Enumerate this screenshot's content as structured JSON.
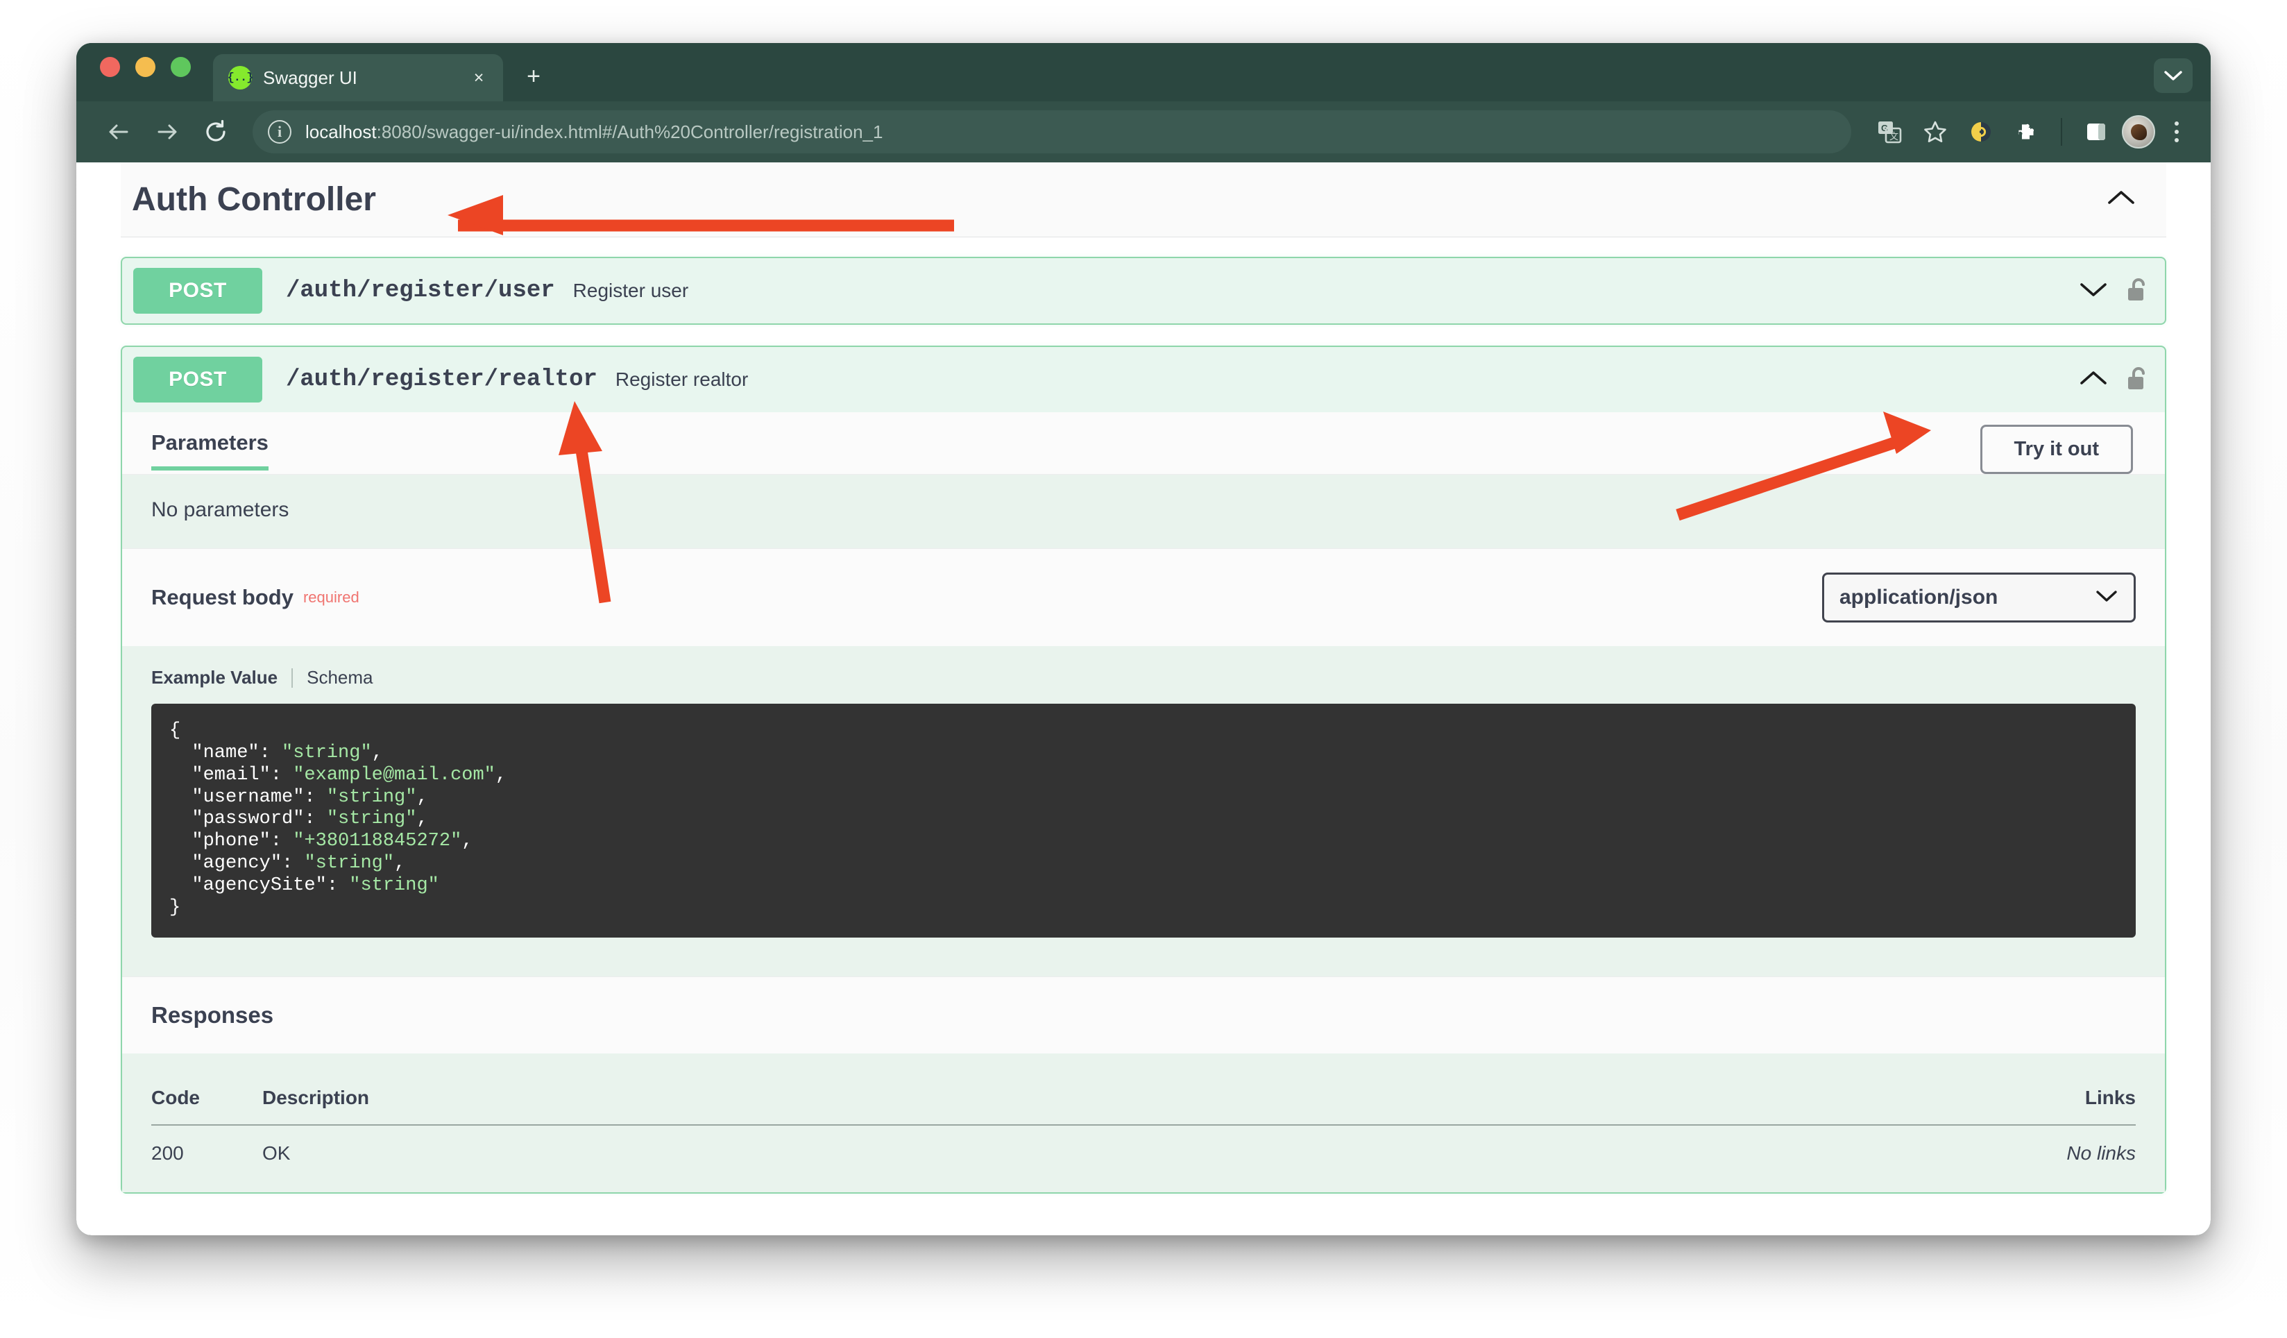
{
  "browser": {
    "window_controls": [
      "close",
      "minimize",
      "maximize"
    ],
    "tab": {
      "title": "Swagger UI",
      "favicon": "{..}",
      "close_label": "×"
    },
    "new_tab_label": "+",
    "tab_list_chevron": "chevron-down",
    "toolbar": {
      "back_label": "←",
      "forward_label": "→",
      "reload_label": "↻",
      "site_info_label": "i",
      "url_host": "localhost",
      "url_rest": ":8080/swagger-ui/index.html#/Auth%20Controller/registration_1",
      "url_full": "localhost:8080/swagger-ui/index.html#/Auth%20Controller/registration_1",
      "icons": [
        "translate-icon",
        "bookmark-star-icon",
        "extension-badge-icon",
        "puzzle-extension-icon",
        "side-panel-icon",
        "profile-avatar",
        "menu-kebab-icon"
      ]
    }
  },
  "swagger": {
    "tag_section": {
      "title": "Auth Controller",
      "collapse_chevron": "chevron-up"
    },
    "operations": [
      {
        "method": "POST",
        "path": "/auth/register/user",
        "summary": "Register user",
        "expanded": false,
        "chevron": "chevron-down",
        "lock": "unlocked-padlock"
      },
      {
        "method": "POST",
        "path": "/auth/register/realtor",
        "summary": "Register realtor",
        "expanded": true,
        "chevron": "chevron-up",
        "lock": "unlocked-padlock"
      }
    ],
    "expanded_operation": {
      "parameters_tab": "Parameters",
      "try_it_out": "Try it out",
      "no_parameters": "No parameters",
      "request_body_label": "Request body",
      "required_badge": "required",
      "media_type_selected": "application/json",
      "media_type_options": [
        "application/json"
      ],
      "example_value_tab": "Example Value",
      "schema_tab": "Schema",
      "example_json_lines": [
        "{",
        "  \"name\": \"string\",",
        "  \"email\": \"example@mail.com\",",
        "  \"username\": \"string\",",
        "  \"password\": \"string\",",
        "  \"phone\": \"+380118845272\",",
        "  \"agency\": \"string\",",
        "  \"agencySite\": \"string\"",
        "}"
      ],
      "example_json_fields": {
        "name": "string",
        "email": "example@mail.com",
        "username": "string",
        "password": "string",
        "phone": "+380118845272",
        "agency": "string",
        "agencySite": "string"
      },
      "responses_title": "Responses",
      "responses_table": {
        "headers": [
          "Code",
          "Description",
          "Links"
        ],
        "rows": [
          {
            "code": "200",
            "description": "OK",
            "links": "No links"
          }
        ]
      }
    }
  },
  "annotations": {
    "color": "#ec4524",
    "arrows": [
      {
        "name": "arrow-to-auth-controller-title",
        "points_to": "Auth Controller"
      },
      {
        "name": "arrow-to-realtor-operation",
        "points_to": "/auth/register/realtor"
      },
      {
        "name": "arrow-to-try-it-out",
        "points_to": "Try it out"
      }
    ]
  },
  "colors": {
    "browser_chrome": "#2b4740",
    "browser_toolbar": "#335048",
    "post_method": "#70d19f",
    "opblock_border": "#8fd6ab",
    "opblock_bg": "#e8f6ef",
    "section_bg": "#e9f3ed",
    "code_bg": "#333333",
    "code_string": "#a5e8a5",
    "required_red": "#f07470",
    "text_primary": "#3b4151",
    "annotation_red": "#ec4524"
  }
}
